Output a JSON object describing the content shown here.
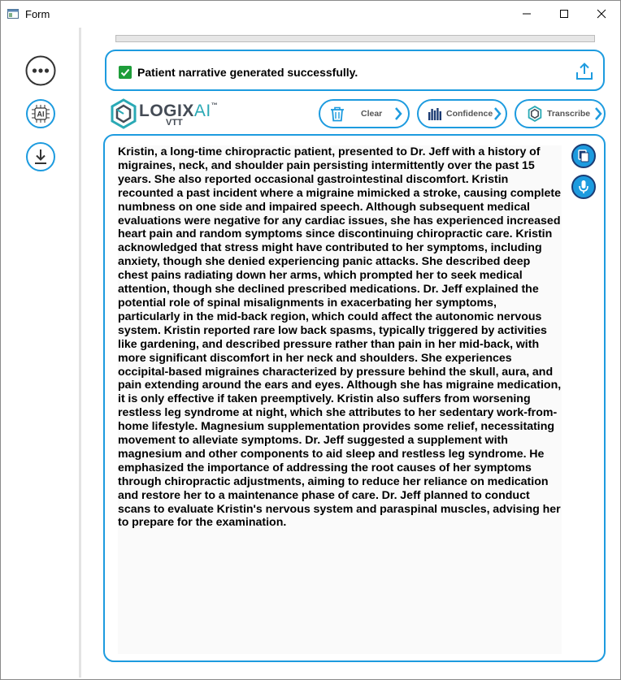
{
  "window": {
    "title": "Form"
  },
  "sidebar": {
    "items": [
      {
        "name": "more-options",
        "icon": "more-horizontal-icon"
      },
      {
        "name": "ai-chip",
        "icon": "ai-chip-icon",
        "label": "AI"
      },
      {
        "name": "download",
        "icon": "download-icon"
      }
    ]
  },
  "progress": {
    "value": 0
  },
  "status": {
    "message": "Patient narrative generated successfully.",
    "icon": "check-icon",
    "color": "#1e9d3a"
  },
  "logo": {
    "name": "LOGIX",
    "ai": "AI",
    "tm": "™",
    "sub": "VTT"
  },
  "toolbar": {
    "clear_label": "Clear",
    "confidence_label": "Confidence",
    "transcribe_label": "Transcribe"
  },
  "narrative": {
    "text": "Kristin, a long-time chiropractic patient, presented to Dr. Jeff with a history of migraines, neck, and shoulder pain persisting intermittently over the past 15 years. She also reported occasional gastrointestinal discomfort. Kristin recounted a past incident where a migraine mimicked a stroke, causing complete numbness on one side and impaired speech. Although subsequent medical evaluations were negative for any cardiac issues, she has experienced increased heart pain and random symptoms since discontinuing chiropractic care. Kristin acknowledged that stress might have contributed to her symptoms, including anxiety, though she denied experiencing panic attacks. She described deep chest pains radiating down her arms, which prompted her to seek medical attention, though she declined prescribed medications. Dr. Jeff explained the potential role of spinal misalignments in exacerbating her symptoms, particularly in the mid-back region, which could affect the autonomic nervous system. Kristin reported rare low back spasms, typically triggered by activities like gardening, and described pressure rather than pain in her mid-back, with more significant discomfort in her neck and shoulders. She experiences occipital-based migraines characterized by pressure behind the skull, aura, and pain extending around the ears and eyes. Although she has migraine medication, it is only effective if taken preemptively. Kristin also suffers from worsening restless leg syndrome at night, which she attributes to her sedentary work-from-home lifestyle. Magnesium supplementation provides some relief, necessitating movement to alleviate symptoms. Dr. Jeff suggested a supplement with magnesium and other components to aid sleep and restless leg syndrome. He emphasized the importance of addressing the root causes of her symptoms through chiropractic adjustments, aiming to reduce her reliance on medication and restore her to a maintenance phase of care. Dr. Jeff planned to conduct scans to evaluate Kristin's nervous system and paraspinal muscles, advising her to prepare for the examination."
  },
  "colors": {
    "accent": "#1d9bdf",
    "dark_button": "#1b3b73",
    "success": "#1e9d3a",
    "logo_teal": "#2aa9b5",
    "logo_gray": "#444b55"
  }
}
